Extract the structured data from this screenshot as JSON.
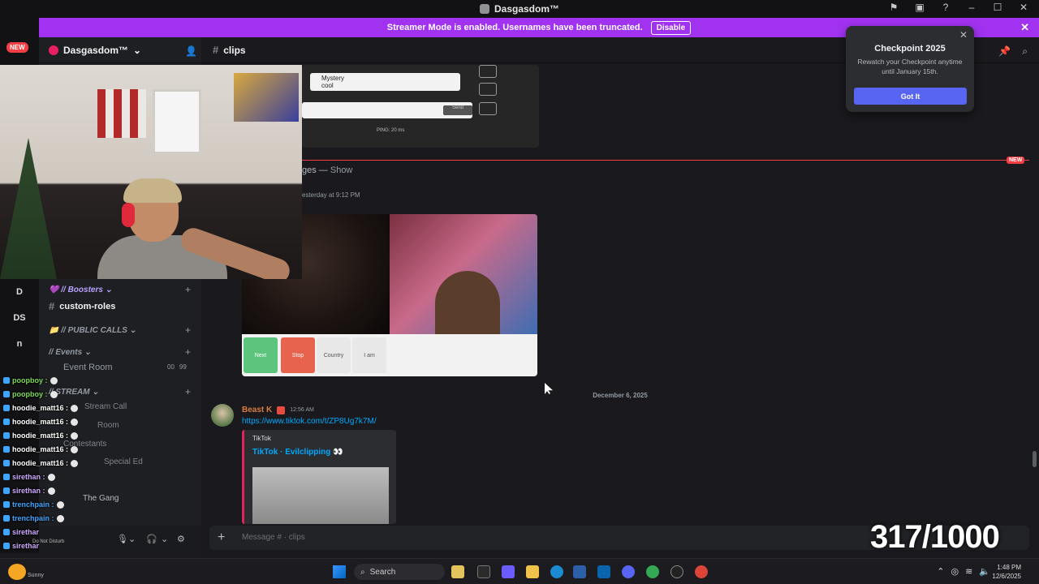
{
  "window": {
    "title": "Dasgasdom™"
  },
  "banner": {
    "text": "Streamer Mode is enabled. Usernames have been truncated.",
    "disable_label": "Disable"
  },
  "rail": {
    "new_label": "NEW",
    "items": [
      "D",
      "DS",
      "n"
    ],
    "badge_count": "1"
  },
  "server": {
    "name": "Dasgasdom™"
  },
  "channel": {
    "name": "clips"
  },
  "sidebar": {
    "boosters_label": "// Boosters",
    "custom_roles": "custom-roles",
    "public_calls_label": "// PUBLIC CALLS",
    "events_label": "// Events",
    "event_room": "Event Room",
    "event_room_count_a": "00",
    "event_room_count_b": "99",
    "stream_label": "// STREAM",
    "stream_call": "Stream Call",
    "room": "Room",
    "contestants": "Contestants",
    "special_ed": "Special Ed",
    "the_gang": "The Gang"
  },
  "chat_overlay": [
    {
      "name": "poopboy :",
      "color": "#7ed957"
    },
    {
      "name": "poopboy :",
      "color": "#7ed957"
    },
    {
      "name": "hoodie_matt16 :",
      "color": "#ffffff"
    },
    {
      "name": "hoodie_matt16 :",
      "color": "#ffffff"
    },
    {
      "name": "hoodie_matt16 :",
      "color": "#ffffff"
    },
    {
      "name": "hoodie_matt16 :",
      "color": "#ffffff"
    },
    {
      "name": "hoodie_matt16 :",
      "color": "#ffffff"
    },
    {
      "name": "sirethan :",
      "color": "#cfa9ff"
    },
    {
      "name": "sirethan :",
      "color": "#cfa9ff"
    },
    {
      "name": "trenchpain :",
      "color": "#3ea6ff"
    },
    {
      "name": "trenchpain :",
      "color": "#3ea6ff"
    },
    {
      "name": "sirethan :",
      "color": "#cfa9ff"
    },
    {
      "name": "sirethan :",
      "color": "#cfa9ff"
    }
  ],
  "messages": {
    "game_chat_name": "Mystery",
    "game_chat_text": "cool",
    "game_send": "Send",
    "game_ping": "PING: 20 ms",
    "new_label": "NEW",
    "ignored_text": "ges — ",
    "ignored_show": "Show",
    "yesterday": "esterday at 9:12 PM",
    "video_buttons": [
      "Next",
      "Stop",
      "Country",
      "I am"
    ],
    "date_divider": "December 6, 2025",
    "author": "Beast K",
    "time": "12:56 AM",
    "link": "https://www.tiktok.com/t/ZP8Ug7k7M/",
    "embed_provider": "TikTok",
    "embed_title": "TikTok · Evilclipping 👀"
  },
  "composer": {
    "placeholder": "Message # · clips"
  },
  "popup": {
    "title": "Checkpoint 2025",
    "body": "Rewatch your Checkpoint anytime until January 15th.",
    "button": "Got It"
  },
  "counter": "317/1000",
  "taskbar": {
    "weather": "Sunny",
    "search": "Search",
    "status": "Do Not Disturb",
    "time": "1:48 PM",
    "date": "12/6/2025"
  }
}
